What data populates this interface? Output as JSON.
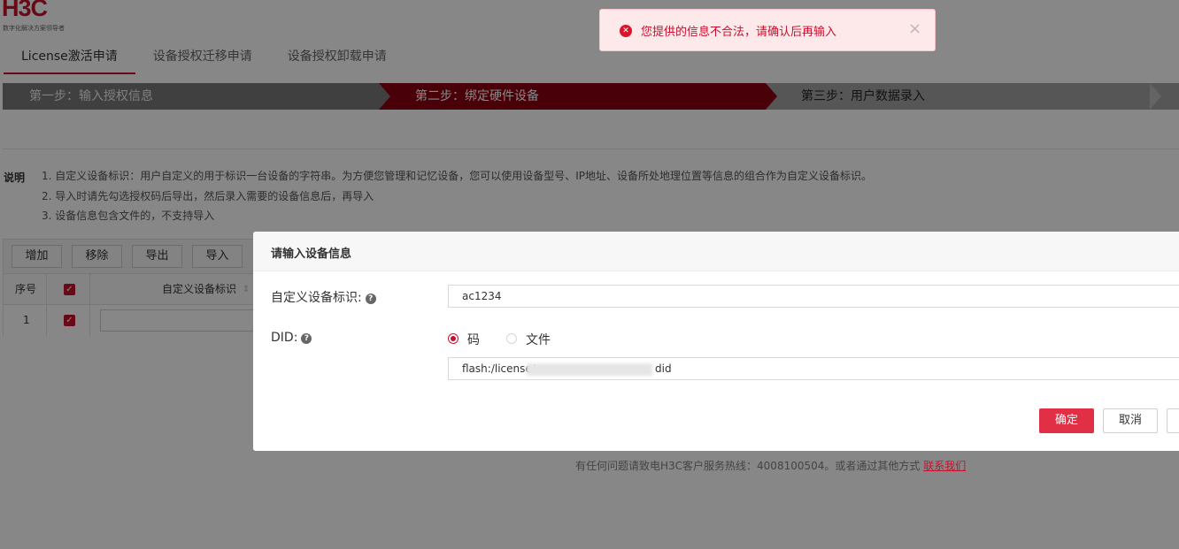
{
  "brand": {
    "logo": "H3C",
    "tagline": "数字化解决方案领导者"
  },
  "tabs": [
    {
      "label": "License激活申请"
    },
    {
      "label": "设备授权迁移申请"
    },
    {
      "label": "设备授权卸载申请"
    }
  ],
  "steps": [
    {
      "label": "第一步：输入授权信息"
    },
    {
      "label": "第二步：绑定硬件设备"
    },
    {
      "label": "第三步：用户数据录入"
    }
  ],
  "notes": {
    "label": "说明",
    "items": [
      "1. 自定义设备标识：用户自定义的用于标识一台设备的字符串。为方便您管理和记忆设备，您可以使用设备型号、IP地址、设备所处地理位置等信息的组合作为自定义设备标识。",
      "2. 导入时请先勾选授权码后导出，然后录入需要的设备信息后，再导入",
      "3. 设备信息包含文件的，不支持导入"
    ]
  },
  "toolbar": {
    "add": "增加",
    "remove": "移除",
    "export": "导出",
    "import": "导入"
  },
  "table": {
    "col_index": "序号",
    "col_device_id": "自定义设备标识",
    "rows": [
      {
        "index": "1"
      }
    ]
  },
  "footer": {
    "text": "有任何问题请致电H3C客户服务热线：4008100504。或者通过其他方式 ",
    "link": "联系我们"
  },
  "modal": {
    "title": "请输入设备信息",
    "device_label": "自定义设备标识:",
    "device_value": "ac1234",
    "did_label": "DID:",
    "radio_code": "码",
    "radio_file": "文件",
    "did_value_prefix": "flash:/license/",
    "did_value_suffix": "did",
    "ok": "确定",
    "cancel": "取消"
  },
  "toast": {
    "message": "您提供的信息不合法，请确认后再输入"
  },
  "colors": {
    "brand_red": "#c8102e",
    "step_active": "#8c0010",
    "ok_button": "#e12f45"
  }
}
